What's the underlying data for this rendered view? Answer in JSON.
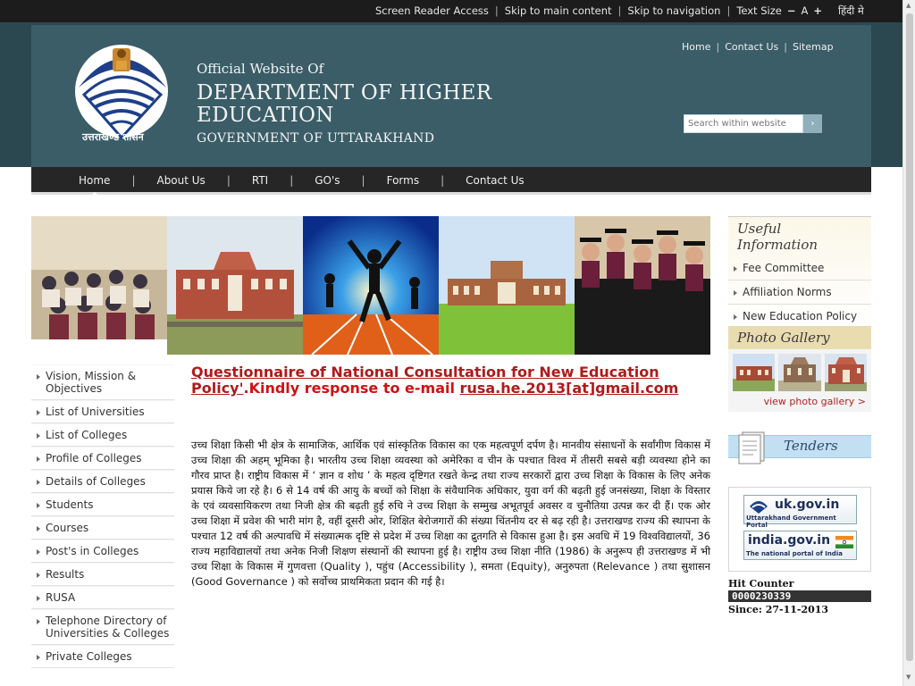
{
  "topbar": {
    "screen_reader": "Screen Reader Access",
    "skip_main": "Skip to main content",
    "skip_nav": "Skip to navigation",
    "text_size": "Text Size",
    "minus": "−",
    "a": "A",
    "plus": "+",
    "hindi": "हिंदी मे"
  },
  "header": {
    "official": "Official Website Of",
    "dept1": "DEPARTMENT OF HIGHER",
    "dept2": "EDUCATION",
    "govt": "GOVERNMENT OF UTTARAKHAND",
    "logo_caption": "उत्तराखण्ड शासन",
    "links": {
      "home": "Home",
      "contact": "Contact Us",
      "sitemap": "Sitemap"
    },
    "search_placeholder": "Search within website"
  },
  "nav": [
    "Home",
    "About Us",
    "RTI",
    "GO's",
    "Forms",
    "Contact Us"
  ],
  "left_menu": [
    "Vision, Mission & Objectives",
    "List of Universities",
    "List of Colleges",
    "Profile of Colleges",
    "Details of Colleges",
    "Students",
    "Courses",
    "Post's in Colleges",
    "Results",
    "RUSA",
    "Telephone Directory of Universities & Colleges",
    "Private Colleges"
  ],
  "main": {
    "announce_link": "Questionnaire of National Consultation for New Education Policy'",
    "announce_mid": ".Kindly response to e-mail ",
    "announce_email": "rusa.he.2013[at]gmail.com",
    "body": "उच्च शिक्षा किसी भी क्षेत्र के सामाजिक, आर्थिक एवं सांस्कृतिक विकास का एक महत्वपूर्ण दर्पण है। मानवीय संसाधनों के सर्वांगीण विकास में उच्च शिक्षा की अहम् भूमिका है। भारतीय उच्च शिक्षा व्यवस्था को अमेरिका व चीन के पश्चात विश्व में तीसरी सबसे बड़ी व्यवस्था होने का गौरव प्राप्त है। राष्ट्रीय विकास में ‘ ज्ञान व शोध ’ के महत्व दृष्टिगत रखते केन्द्र तथा राज्य सरकारों द्वारा उच्च शिक्षा के विकास के लिए अनेक प्रयास किये जा रहे है। 6 से 14 वर्ष की आयु के बच्चों को शिक्षा के संवैधानिक अधिकार, युवा वर्ग की बढ़ती हुई जनसंख्या, शिक्षा के विस्तार के एवं व्यवसायिकरण तथा निजी क्षेत्र की बढ़ती हुई रुचि ने उच्च शिक्षा के सम्मुख अभूतपूर्व अवसर व चुनौतिया उत्पन्न कर दी हैं। एक ओर उच्च शिक्षा में प्रवेश की भारी मांग है, वहीं दूसरी ओर, शिक्षित बेरोजगारों की संख्या चिंतनीय दर से बढ़ रही है। उत्तराखण्ड राज्य की स्थापना के पश्चात 12 वर्ष की अल्पावधि में संख्यात्मक दृष्टि से प्रदेश में उच्च शिक्षा का द्रुतगति से विकास हुआ है। इस अवधि में 19 विश्वविद्यालयों, 36 राज्य महाविद्यालयों तथा अनेक निजी शिक्षण संस्थानों की स्थापना हुई है। राष्ट्रीय उच्च शिक्षा नीति (1986) के अनुरूप ही उत्तराखण्ड में भी उच्च शिक्षा के विकास में गुणवत्ता (Quality ), पहुंच (Accessibility ), समता (Equity), अनुरुपता (Relevance ) तथा सुशासन (Good Governance ) को सर्वोच्च प्राथमिकता प्रदान की गई है।"
  },
  "right": {
    "useful_title": "Useful Information",
    "useful": [
      "Fee Committee",
      "Affiliation Norms",
      "New Education Policy"
    ],
    "gallery_title": "Photo Gallery",
    "gallery_more": "view photo gallery >",
    "tenders": "Tenders",
    "portal1_big": "uk.gov.in",
    "portal1_small": "Uttarakhand Government Portal",
    "portal2_big": "india.gov.in",
    "portal2_small": "The national portal of India",
    "hit_label": "Hit Counter",
    "hit_count": "0000230339",
    "since": "Since: 27-11-2013"
  }
}
